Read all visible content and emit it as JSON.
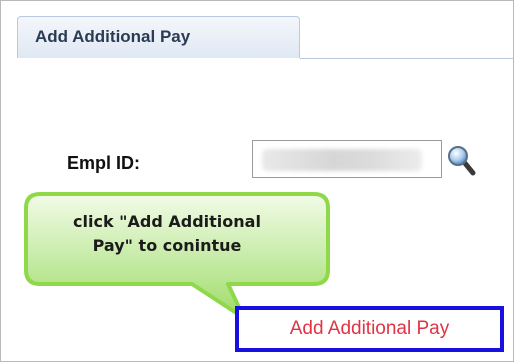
{
  "tab": {
    "label": "Add Additional Pay"
  },
  "form": {
    "empl_id_label": "Empl ID:",
    "empl_id_value": ""
  },
  "icons": {
    "lookup": "magnifying-glass-icon"
  },
  "callout": {
    "line1": "click \"Add Additional",
    "line2": "Pay\" to conintue",
    "color": "#8ed84a"
  },
  "action": {
    "add_link_label": "Add Additional Pay",
    "link_color": "#e03344",
    "highlight_color": "#1710e0"
  }
}
